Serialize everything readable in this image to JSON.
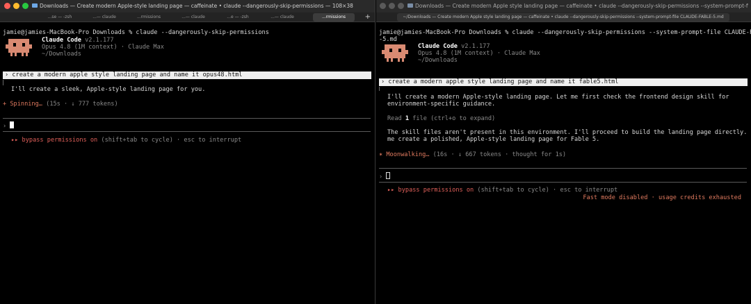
{
  "left": {
    "window_title": "Downloads —  Create modern Apple-style landing page — caffeinate • claude --dangerously-skip-permissions — 108×38",
    "tabs": [
      "...se — -zsh",
      "...— claude",
      "...rmissions",
      "...— claude",
      "...e — -zsh",
      "...— claude",
      "...rmissions"
    ],
    "active_tab_index": 6,
    "command_line": "jamie@jamies-MacBook-Pro Downloads % claude --dangerously-skip-permissions",
    "app_name": "Claude Code",
    "app_version": "v2.1.177",
    "model_line": "Opus 4.8 (1M context) · Claude Max",
    "cwd": "~/Downloads",
    "user_prompt": "› create a modern apple style landing page and name it opus48.html",
    "response": "I'll create a sleek, Apple-style landing page for you.",
    "status_glyph": "+",
    "status_word": "Spinning…",
    "status_meta": "(15s · ↓ 777 tokens)",
    "input_prompt_glyph": "›",
    "mode_glyph": "▸▸",
    "mode_label": "bypass permissions on",
    "mode_hint": "(shift+tab to cycle) · esc to interrupt"
  },
  "right": {
    "window_title": "Downloads — Create modern Apple style landing page — caffeinate • claude --dangerously-skip-permissions --system-prompt-file CLA...",
    "tab_label": "~/Downloads — Create modern Apple style landing page — caffeinate • claude --dangerously-skip-permissions --system-prompt-file CLAUDE-FABLE-5.md",
    "command_line_1": "jamie@jamies-MacBook-Pro Downloads % claude --dangerously-skip-permissions --system-prompt-file CLAUDE-FABLE",
    "command_line_2": "-5.md",
    "app_name": "Claude Code",
    "app_version": "v2.1.177",
    "model_line": "Opus 4.8 (1M context) · Claude Max",
    "cwd": "~/Downloads",
    "user_prompt": "› create a modern apple style landing page and name it fable5.html",
    "response_1a": "I'll create a modern Apple-style landing page. Let me first check the frontend design skill for",
    "response_1b": "environment-specific guidance.",
    "read_prefix": "Read ",
    "read_count": "1",
    "read_suffix": " file (ctrl+o to expand)",
    "response_2a": "The skill files aren't present in this environment. I'll proceed to build the landing page directly. Let",
    "response_2b": "me create a polished, Apple-style landing page for Fable 5.",
    "status_glyph": "✶",
    "status_word": "Moonwalking…",
    "status_meta": "(16s · ↓ 667 tokens · thought for 1s)",
    "input_prompt_glyph": "›",
    "mode_glyph": "▸▸",
    "mode_label": "bypass permissions on",
    "mode_hint": "(shift+tab to cycle) · esc to interrupt",
    "notice": "Fast mode disabled · usage credits exhausted"
  },
  "colors": {
    "accent_orange": "#e07a5f",
    "mode_red": "#e0605a",
    "avatar": "#d98a72"
  }
}
